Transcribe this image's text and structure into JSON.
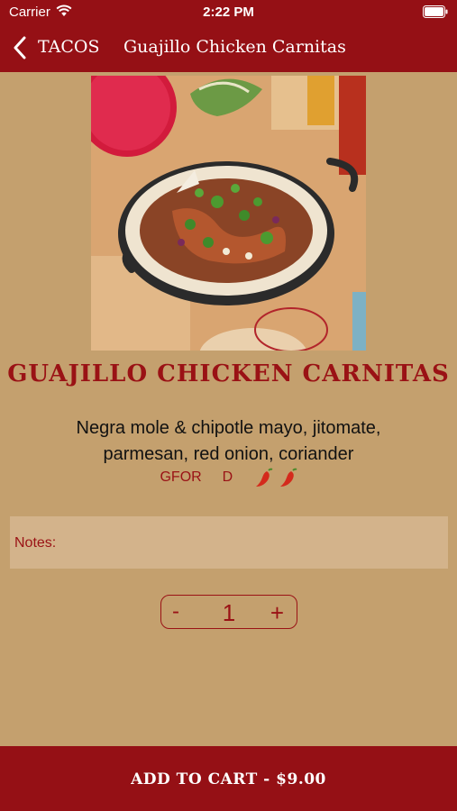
{
  "status_bar": {
    "carrier": "Carrier",
    "time": "2:22 PM"
  },
  "nav": {
    "back_label": "TACOS",
    "title": "Guajillo Chicken Carnitas"
  },
  "dish": {
    "name": "GUAJILLO CHICKEN CARNITAS",
    "description": "Negra mole & chipotle mayo, jitomate, parmesan, red onion, coriander",
    "tags": [
      "GFOR",
      "D"
    ],
    "spice_icons": [
      "chili-pepper-icon",
      "chili-pepper-icon"
    ]
  },
  "notes": {
    "label": "Notes:"
  },
  "quantity": {
    "minus": "-",
    "value": "1",
    "plus": "+"
  },
  "cart": {
    "label": "ADD TO CART - $9.00"
  },
  "colors": {
    "brand_red": "#951015",
    "background": "#c4a06e",
    "notes_bg": "#d3b38b"
  }
}
